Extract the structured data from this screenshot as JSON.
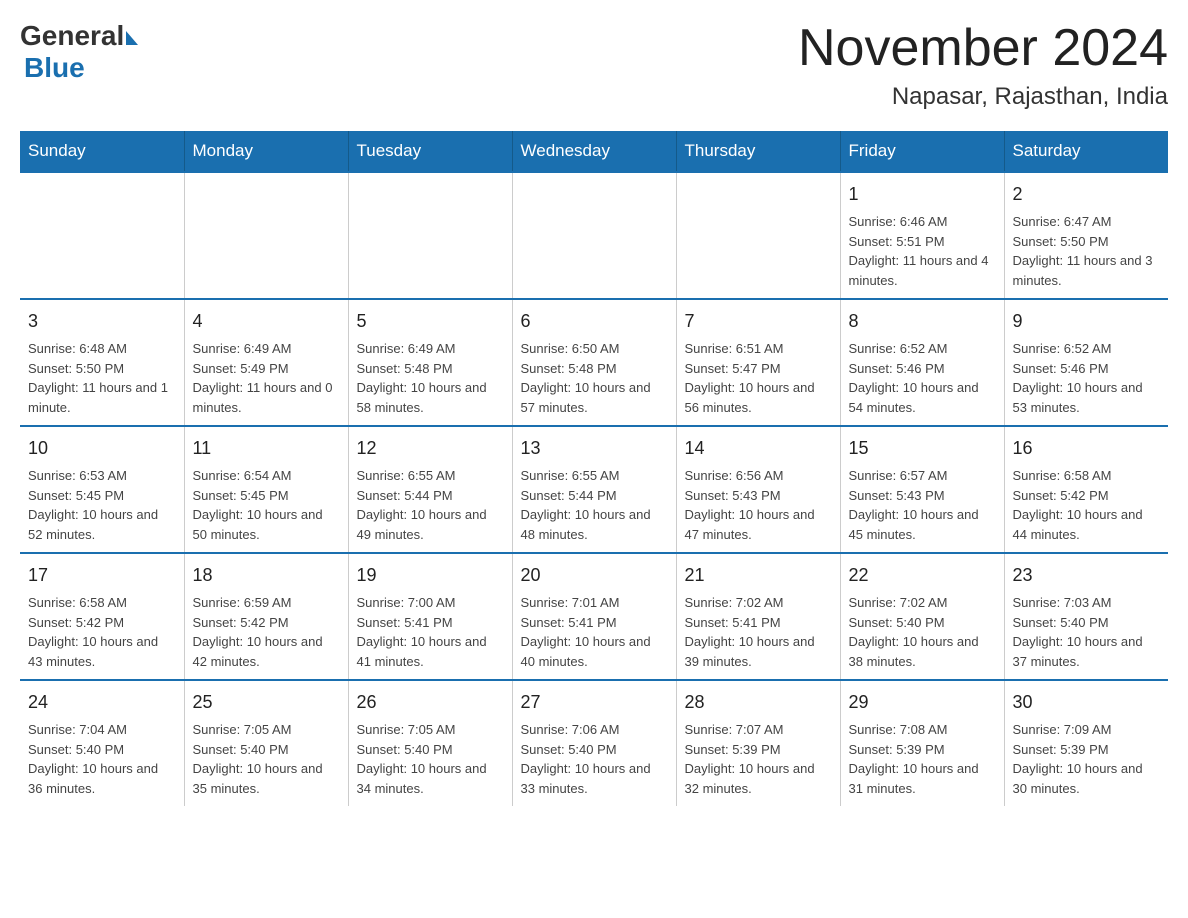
{
  "header": {
    "logo_general": "General",
    "logo_blue": "Blue",
    "month_title": "November 2024",
    "location": "Napasar, Rajasthan, India"
  },
  "days_of_week": [
    "Sunday",
    "Monday",
    "Tuesday",
    "Wednesday",
    "Thursday",
    "Friday",
    "Saturday"
  ],
  "weeks": [
    [
      {
        "day": "",
        "info": ""
      },
      {
        "day": "",
        "info": ""
      },
      {
        "day": "",
        "info": ""
      },
      {
        "day": "",
        "info": ""
      },
      {
        "day": "",
        "info": ""
      },
      {
        "day": "1",
        "info": "Sunrise: 6:46 AM\nSunset: 5:51 PM\nDaylight: 11 hours and 4 minutes."
      },
      {
        "day": "2",
        "info": "Sunrise: 6:47 AM\nSunset: 5:50 PM\nDaylight: 11 hours and 3 minutes."
      }
    ],
    [
      {
        "day": "3",
        "info": "Sunrise: 6:48 AM\nSunset: 5:50 PM\nDaylight: 11 hours and 1 minute."
      },
      {
        "day": "4",
        "info": "Sunrise: 6:49 AM\nSunset: 5:49 PM\nDaylight: 11 hours and 0 minutes."
      },
      {
        "day": "5",
        "info": "Sunrise: 6:49 AM\nSunset: 5:48 PM\nDaylight: 10 hours and 58 minutes."
      },
      {
        "day": "6",
        "info": "Sunrise: 6:50 AM\nSunset: 5:48 PM\nDaylight: 10 hours and 57 minutes."
      },
      {
        "day": "7",
        "info": "Sunrise: 6:51 AM\nSunset: 5:47 PM\nDaylight: 10 hours and 56 minutes."
      },
      {
        "day": "8",
        "info": "Sunrise: 6:52 AM\nSunset: 5:46 PM\nDaylight: 10 hours and 54 minutes."
      },
      {
        "day": "9",
        "info": "Sunrise: 6:52 AM\nSunset: 5:46 PM\nDaylight: 10 hours and 53 minutes."
      }
    ],
    [
      {
        "day": "10",
        "info": "Sunrise: 6:53 AM\nSunset: 5:45 PM\nDaylight: 10 hours and 52 minutes."
      },
      {
        "day": "11",
        "info": "Sunrise: 6:54 AM\nSunset: 5:45 PM\nDaylight: 10 hours and 50 minutes."
      },
      {
        "day": "12",
        "info": "Sunrise: 6:55 AM\nSunset: 5:44 PM\nDaylight: 10 hours and 49 minutes."
      },
      {
        "day": "13",
        "info": "Sunrise: 6:55 AM\nSunset: 5:44 PM\nDaylight: 10 hours and 48 minutes."
      },
      {
        "day": "14",
        "info": "Sunrise: 6:56 AM\nSunset: 5:43 PM\nDaylight: 10 hours and 47 minutes."
      },
      {
        "day": "15",
        "info": "Sunrise: 6:57 AM\nSunset: 5:43 PM\nDaylight: 10 hours and 45 minutes."
      },
      {
        "day": "16",
        "info": "Sunrise: 6:58 AM\nSunset: 5:42 PM\nDaylight: 10 hours and 44 minutes."
      }
    ],
    [
      {
        "day": "17",
        "info": "Sunrise: 6:58 AM\nSunset: 5:42 PM\nDaylight: 10 hours and 43 minutes."
      },
      {
        "day": "18",
        "info": "Sunrise: 6:59 AM\nSunset: 5:42 PM\nDaylight: 10 hours and 42 minutes."
      },
      {
        "day": "19",
        "info": "Sunrise: 7:00 AM\nSunset: 5:41 PM\nDaylight: 10 hours and 41 minutes."
      },
      {
        "day": "20",
        "info": "Sunrise: 7:01 AM\nSunset: 5:41 PM\nDaylight: 10 hours and 40 minutes."
      },
      {
        "day": "21",
        "info": "Sunrise: 7:02 AM\nSunset: 5:41 PM\nDaylight: 10 hours and 39 minutes."
      },
      {
        "day": "22",
        "info": "Sunrise: 7:02 AM\nSunset: 5:40 PM\nDaylight: 10 hours and 38 minutes."
      },
      {
        "day": "23",
        "info": "Sunrise: 7:03 AM\nSunset: 5:40 PM\nDaylight: 10 hours and 37 minutes."
      }
    ],
    [
      {
        "day": "24",
        "info": "Sunrise: 7:04 AM\nSunset: 5:40 PM\nDaylight: 10 hours and 36 minutes."
      },
      {
        "day": "25",
        "info": "Sunrise: 7:05 AM\nSunset: 5:40 PM\nDaylight: 10 hours and 35 minutes."
      },
      {
        "day": "26",
        "info": "Sunrise: 7:05 AM\nSunset: 5:40 PM\nDaylight: 10 hours and 34 minutes."
      },
      {
        "day": "27",
        "info": "Sunrise: 7:06 AM\nSunset: 5:40 PM\nDaylight: 10 hours and 33 minutes."
      },
      {
        "day": "28",
        "info": "Sunrise: 7:07 AM\nSunset: 5:39 PM\nDaylight: 10 hours and 32 minutes."
      },
      {
        "day": "29",
        "info": "Sunrise: 7:08 AM\nSunset: 5:39 PM\nDaylight: 10 hours and 31 minutes."
      },
      {
        "day": "30",
        "info": "Sunrise: 7:09 AM\nSunset: 5:39 PM\nDaylight: 10 hours and 30 minutes."
      }
    ]
  ]
}
